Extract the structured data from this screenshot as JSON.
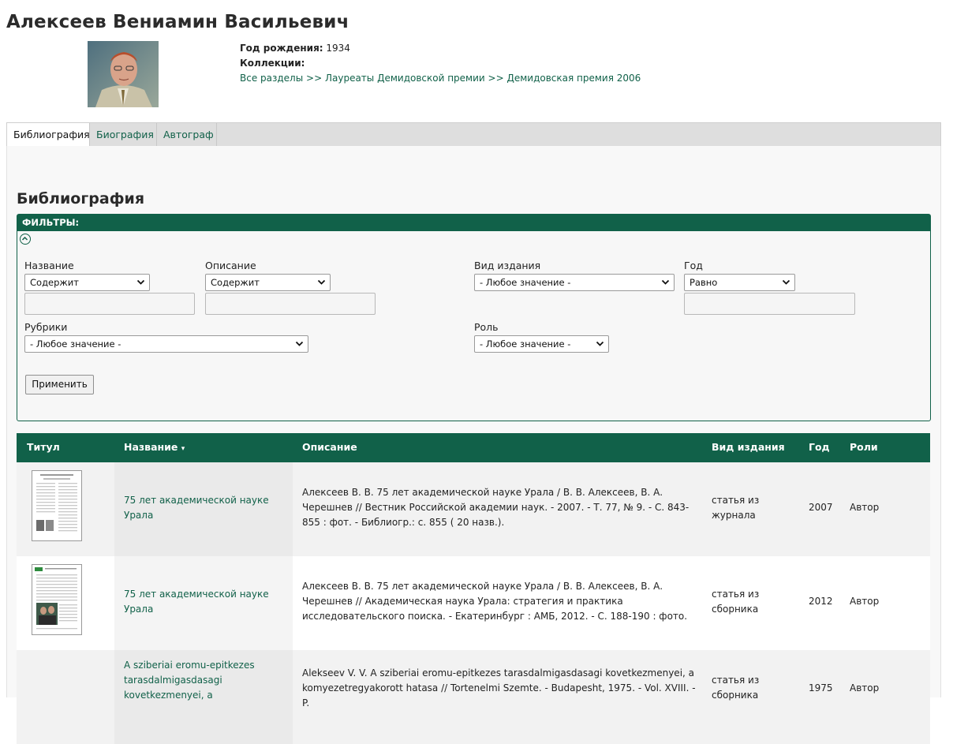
{
  "person": {
    "name": "Алексеев Вениамин Васильевич",
    "birth_label": "Год рождения:",
    "birth_year": "1934",
    "collections_label": "Коллекции:",
    "breadcrumb": [
      "Все разделы",
      "Лауреаты Демидовской премии",
      "Демидовская премия 2006"
    ],
    "breadcrumb_sep": ">>"
  },
  "tabs": [
    {
      "label": "Библиография",
      "active": true
    },
    {
      "label": "Биография",
      "active": false
    },
    {
      "label": "Автограф",
      "active": false
    }
  ],
  "section_title": "Библиография",
  "filters": {
    "header": "ФИЛЬТРЫ:",
    "name_label": "Название",
    "name_select": "Содержит",
    "name_value": "",
    "desc_label": "Описание",
    "desc_select": "Содержит",
    "desc_value": "",
    "type_label": "Вид издания",
    "type_select": "- Любое значение -",
    "year_label": "Год",
    "year_select": "Равно",
    "year_value": "",
    "rubric_label": "Рубрики",
    "rubric_select": "- Любое значение -",
    "role_label": "Роль",
    "role_select": "- Любое значение -",
    "apply": "Применить"
  },
  "table": {
    "headers": {
      "cover": "Титул",
      "name": "Название",
      "desc": "Описание",
      "type": "Вид издания",
      "year": "Год",
      "roles": "Роли"
    },
    "sort_indicator": "▾",
    "rows": [
      {
        "name": "75 лет академической науке Урала",
        "desc": "Алексеев В. В. 75 лет академической науке Урала / В. В. Алексеев, В. А. Черешнев // Вестник Российской академии наук. - 2007. - Т. 77, № 9. - С. 843-855 : фот. - Библиогр.: с. 855 ( 20 назв.).",
        "type": "статья из журнала",
        "year": "2007",
        "role": "Автор"
      },
      {
        "name": "75 лет академической науке Урала",
        "desc": "Алексеев В. В. 75 лет академической науке Урала / В. В. Алексеев, В. А. Черешнев // Академическая наука Урала: стратегия и практика исследовательского поиска. - Екатеринбург : АМБ, 2012. - С. 188-190 : фото.",
        "type": "статья из сборника",
        "year": "2012",
        "role": "Автор"
      },
      {
        "name": "A sziberiai eromu-epitkezes tarasdalmigasdasagi kovetkezmenyei, a",
        "desc": "Alekseev V. V. A sziberiai eromu-epitkezes tarasdalmigasdasagi kovetkezmenyei, a komyezetregyakorott hatasa // Tortenelmi Szemte. - Budapesht, 1975. - Vol. XVIII. - P.",
        "type": "статья из сборника",
        "year": "1975",
        "role": "Автор"
      }
    ]
  },
  "colors": {
    "accent": "#116149",
    "link": "#116149"
  }
}
